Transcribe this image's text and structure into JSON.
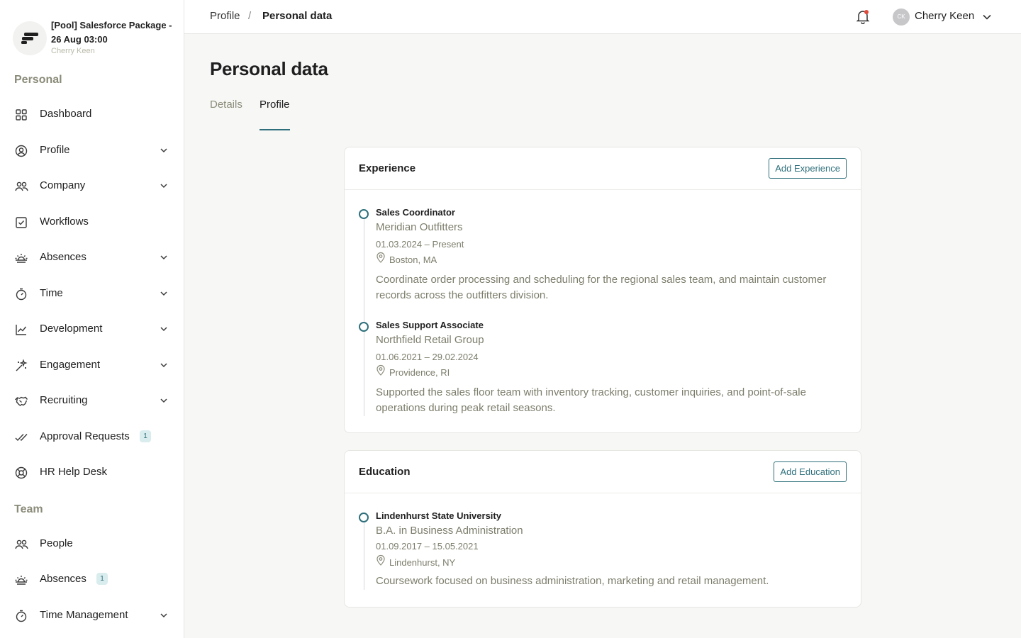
{
  "brand": {
    "title": "[Pool] Salesforce Package - 26 Aug 03:00",
    "user": "Cherry Keen",
    "logo_icon": "company-logo-icon"
  },
  "sidebar": {
    "personal_title": "Personal",
    "personal_items": [
      {
        "label": "Dashboard",
        "icon": "grid-icon",
        "chevron": false
      },
      {
        "label": "Profile",
        "icon": "user-circle-icon",
        "chevron": true
      },
      {
        "label": "Company",
        "icon": "users-icon",
        "chevron": true
      },
      {
        "label": "Workflows",
        "icon": "checkbox-icon",
        "chevron": false
      },
      {
        "label": "Absences",
        "icon": "sunrise-icon",
        "chevron": true
      },
      {
        "label": "Time",
        "icon": "stopwatch-icon",
        "chevron": true
      },
      {
        "label": "Development",
        "icon": "chart-line-icon",
        "chevron": true
      },
      {
        "label": "Engagement",
        "icon": "sparkle-icon",
        "chevron": true
      },
      {
        "label": "Recruiting",
        "icon": "handshake-icon",
        "chevron": true
      },
      {
        "label": "Approval Requests",
        "icon": "double-check-icon",
        "chevron": false,
        "badge": "1"
      },
      {
        "label": "HR Help Desk",
        "icon": "lifebuoy-icon",
        "chevron": false
      }
    ],
    "team_title": "Team",
    "team_items": [
      {
        "label": "People",
        "icon": "users-icon",
        "chevron": false
      },
      {
        "label": "Absences",
        "icon": "sunrise-icon",
        "chevron": false,
        "badge": "1"
      },
      {
        "label": "Time Management",
        "icon": "stopwatch-icon",
        "chevron": true
      }
    ]
  },
  "header": {
    "breadcrumb_parent": "Profile",
    "breadcrumb_separator": "/",
    "breadcrumb_current": "Personal data",
    "avatar_initials": "CK",
    "user_name": "Cherry Keen"
  },
  "main": {
    "title": "Personal data",
    "tabs": [
      {
        "label": "Details",
        "active": false
      },
      {
        "label": "Profile",
        "active": true
      }
    ]
  },
  "experience": {
    "title": "Experience",
    "add_label": "Add Experience",
    "entries": [
      {
        "title": "Sales Coordinator",
        "org": "Meridian Outfitters",
        "dates": "01.03.2024 – Present",
        "location": "Boston, MA",
        "description": "Coordinate order processing and scheduling for the regional sales team, and maintain customer records across the outfitters division."
      },
      {
        "title": "Sales Support Associate",
        "org": "Northfield Retail Group",
        "dates": "01.06.2021 – 29.02.2024",
        "location": "Providence, RI",
        "description": "Supported the sales floor team with inventory tracking, customer inquiries, and point-of-sale operations during peak retail seasons."
      }
    ]
  },
  "education": {
    "title": "Education",
    "add_label": "Add Education",
    "entries": [
      {
        "title": "Lindenhurst State University",
        "org": "B.A. in Business Administration",
        "dates": "01.09.2017 – 15.05.2021",
        "location": "Lindenhurst, NY",
        "description": "Coursework focused on business administration, marketing and retail management."
      }
    ]
  },
  "colors": {
    "accent": "#2e6f7b",
    "muted_text": "#7d7d6c",
    "notification": "#e24a3b"
  }
}
